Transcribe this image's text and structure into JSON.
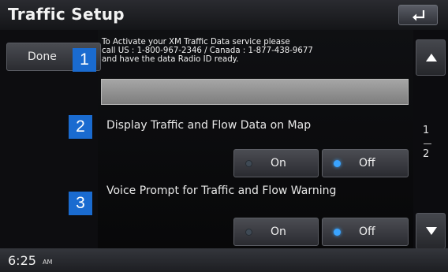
{
  "header": {
    "title": "Traffic Setup",
    "back_icon": "return-arrow-icon"
  },
  "done_label": "Done",
  "info_lines": [
    "To Activate your XM Traffic Data service please",
    "call US : 1-800-967-2346 / Canada : 1-877-438-9677",
    "and have the data Radio ID ready."
  ],
  "radio_id_value": "",
  "settings": [
    {
      "label": "Display Traffic and Flow Data on Map",
      "on_label": "On",
      "off_label": "Off",
      "selected": "Off"
    },
    {
      "label": "Voice Prompt for Traffic and Flow Warning",
      "on_label": "On",
      "off_label": "Off",
      "selected": "Off"
    }
  ],
  "callouts": [
    "1",
    "2",
    "3"
  ],
  "page": {
    "current": "1",
    "total": "2"
  },
  "status": {
    "time": "6:25",
    "ampm": "AM"
  },
  "colors": {
    "callout": "#1a6bd0",
    "selected_dot": "#3aa4ff",
    "field": "#9a9a9a"
  }
}
